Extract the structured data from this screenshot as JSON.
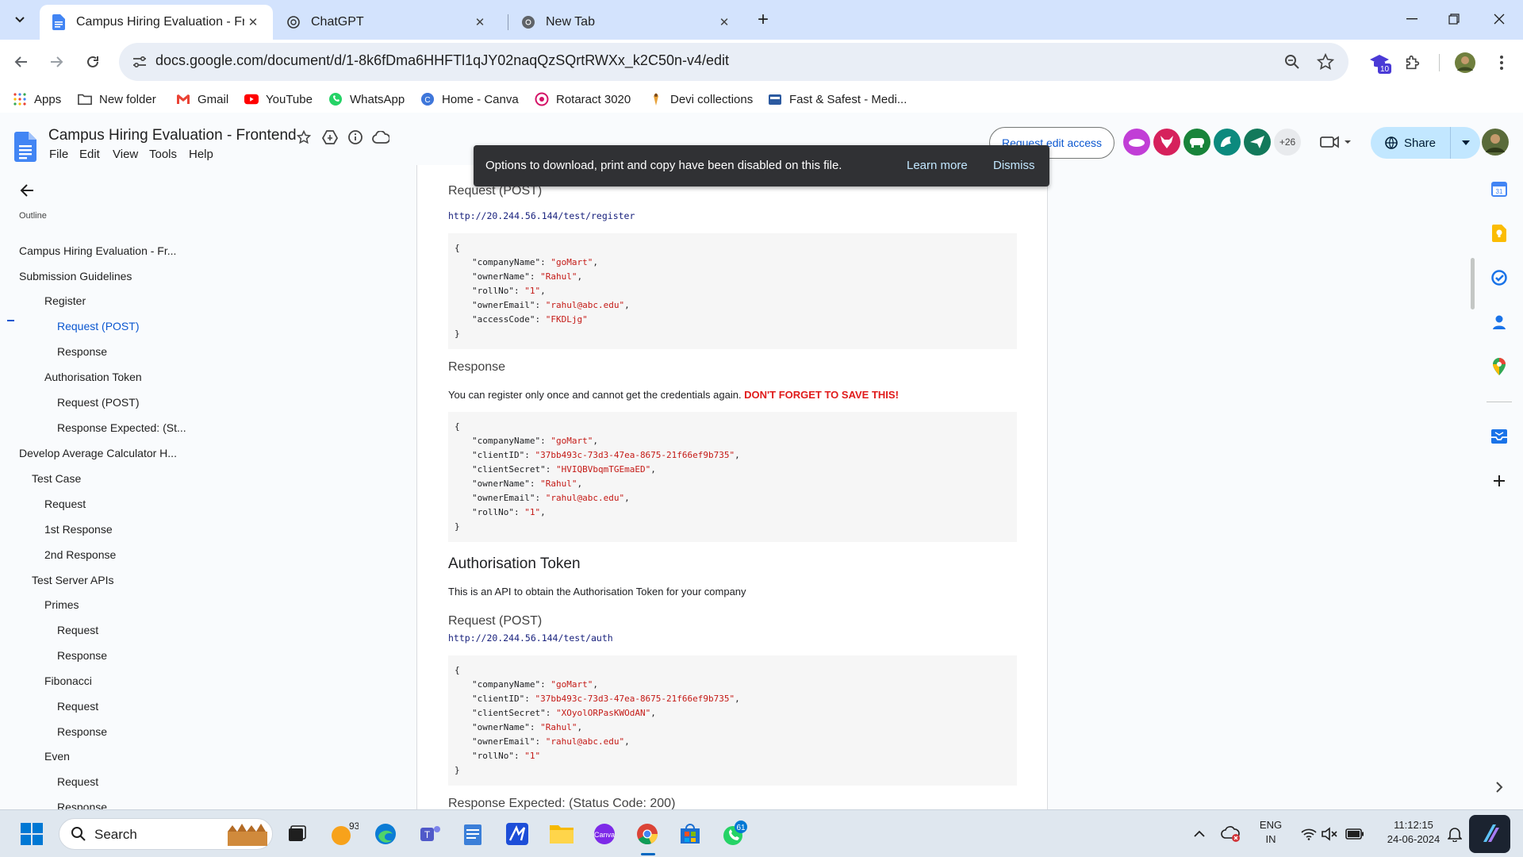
{
  "browser": {
    "tabs": [
      {
        "title": "Campus Hiring Evaluation - Fro",
        "active": true
      },
      {
        "title": "ChatGPT",
        "active": false
      },
      {
        "title": "New Tab",
        "active": false
      }
    ],
    "url": "docs.google.com/document/d/1-8k6fDma6HHFTl1qJY02naqQzSQrtRWXx_k2C50n-v4/edit",
    "extension_badge": "10",
    "bookmarks": [
      "Apps",
      "New folder",
      "Gmail",
      "YouTube",
      "WhatsApp",
      "Home - Canva",
      "Rotaract 3020",
      "Devi collections",
      "Fast & Safest - Medi..."
    ]
  },
  "docs": {
    "title": "Campus Hiring Evaluation - Frontend",
    "menu": [
      "File",
      "Edit",
      "View",
      "Tools",
      "Help"
    ],
    "request_edit_label": "Request edit access",
    "more_users": "+26",
    "share_label": "Share"
  },
  "outline": {
    "heading": "Outline",
    "items": [
      {
        "label": "Campus Hiring Evaluation - Fr...",
        "level": 0
      },
      {
        "label": "Submission Guidelines",
        "level": 0
      },
      {
        "label": "Register",
        "level": 2
      },
      {
        "label": "Request (POST)",
        "level": 3,
        "active": true
      },
      {
        "label": "Response",
        "level": 3
      },
      {
        "label": "Authorisation Token",
        "level": 2
      },
      {
        "label": "Request (POST)",
        "level": 3
      },
      {
        "label": "Response Expected: (St...",
        "level": 3
      },
      {
        "label": "Develop Average Calculator H...",
        "level": 0
      },
      {
        "label": "Test Case",
        "level": 1
      },
      {
        "label": "Request",
        "level": 2
      },
      {
        "label": "1st Response",
        "level": 2
      },
      {
        "label": "2nd Response",
        "level": 2
      },
      {
        "label": "Test Server APIs",
        "level": 1
      },
      {
        "label": "Primes",
        "level": 2
      },
      {
        "label": "Request",
        "level": 3
      },
      {
        "label": "Response",
        "level": 3
      },
      {
        "label": "Fibonacci",
        "level": 2
      },
      {
        "label": "Request",
        "level": 3
      },
      {
        "label": "Response",
        "level": 3
      },
      {
        "label": "Even",
        "level": 2
      },
      {
        "label": "Request",
        "level": 3
      },
      {
        "label": "Response",
        "level": 3
      }
    ]
  },
  "snackbar": {
    "message": "Options to download, print and copy have been disabled on this file.",
    "learn_more": "Learn more",
    "dismiss": "Dismiss"
  },
  "document": {
    "register_request_heading": "Request (POST)",
    "register_url": "http://20.244.56.144/test/register",
    "register_body": [
      {
        "key": "companyName",
        "value": "goMart",
        "comma": ","
      },
      {
        "key": "ownerName",
        "value": "Rahul",
        "comma": ","
      },
      {
        "key": "rollNo",
        "value": "1",
        "comma": ","
      },
      {
        "key": "ownerEmail",
        "value": "rahul@abc.edu",
        "comma": ","
      },
      {
        "key": "accessCode",
        "value": "FKDLjg",
        "comma": ""
      }
    ],
    "response_heading": "Response",
    "response_note": "You can register only once and cannot get the credentials again. ",
    "response_warning": "DON'T FORGET TO SAVE THIS!",
    "register_response": [
      {
        "key": "companyName",
        "value": "goMart",
        "comma": ","
      },
      {
        "key": "clientID",
        "value": "37bb493c-73d3-47ea-8675-21f66ef9b735",
        "comma": ","
      },
      {
        "key": "clientSecret",
        "value": "HVIQBVbqmTGEmaED",
        "comma": ","
      },
      {
        "key": "ownerName",
        "value": "Rahul",
        "comma": ","
      },
      {
        "key": "ownerEmail",
        "value": "rahul@abc.edu",
        "comma": ","
      },
      {
        "key": "rollNo",
        "value": "1",
        "comma": ","
      }
    ],
    "auth_heading": "Authorisation Token",
    "auth_description": "This is an API to obtain the Authorisation Token for your company",
    "auth_request_heading": "Request (POST)",
    "auth_url": "http://20.244.56.144/test/auth",
    "auth_body": [
      {
        "key": "companyName",
        "value": "goMart",
        "comma": ","
      },
      {
        "key": "clientID",
        "value": "37bb493c-73d3-47ea-8675-21f66ef9b735",
        "comma": ","
      },
      {
        "key": "clientSecret",
        "value": "XOyolORPasKWOdAN",
        "comma": ","
      },
      {
        "key": "ownerName",
        "value": "Rahul",
        "comma": ","
      },
      {
        "key": "ownerEmail",
        "value": "rahul@abc.edu",
        "comma": ","
      },
      {
        "key": "rollNo",
        "value": "1",
        "comma": ""
      }
    ],
    "response_expected_heading": "Response Expected: (Status Code: 200)",
    "brace_open": "{",
    "brace_close": "}"
  },
  "taskbar": {
    "search_label": "Search",
    "weather": "93°",
    "whatsapp_badge": "61",
    "lang_top": "ENG",
    "lang_bottom": "IN",
    "time": "11:12:15",
    "date": "24-06-2024"
  },
  "colors": {
    "tabstrip": "#d3e3fd",
    "accent": "#0b57d0",
    "share": "#c2e7ff",
    "code_string": "#c41a16",
    "warning": "#e01b1b"
  }
}
